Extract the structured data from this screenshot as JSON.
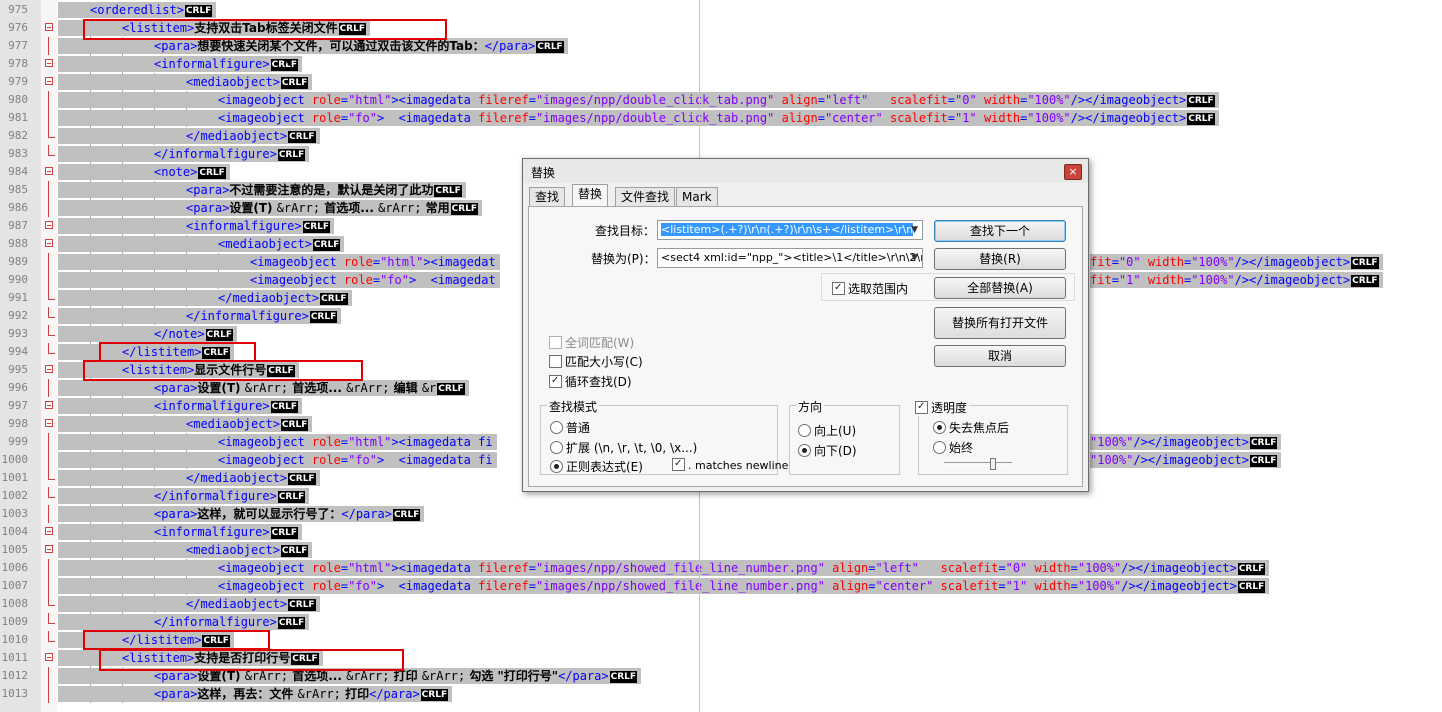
{
  "editor": {
    "lines": [
      {
        "n": "975",
        "indent": 0,
        "fold": "none",
        "segs": [
          [
            "tag",
            "<orderedlist>"
          ]
        ]
      },
      {
        "n": "976",
        "indent": 1,
        "fold": "open",
        "segs": [
          [
            "tag",
            "<listitem>"
          ],
          [
            "txt",
            "支持双击Tab标签关闭文件"
          ]
        ]
      },
      {
        "n": "977",
        "indent": 2,
        "fold": "line",
        "segs": [
          [
            "tag",
            "<para>"
          ],
          [
            "txt",
            "想要快速关闭某个文件，可以通过双击该文件的Tab："
          ],
          [
            "tag",
            "</para>"
          ]
        ]
      },
      {
        "n": "978",
        "indent": 2,
        "fold": "open",
        "segs": [
          [
            "tag",
            "<informalfigure>"
          ]
        ]
      },
      {
        "n": "979",
        "indent": 3,
        "fold": "open",
        "segs": [
          [
            "tag",
            "<mediaobject>"
          ]
        ]
      },
      {
        "n": "980",
        "indent": 4,
        "fold": "line",
        "segs": [
          [
            "tag",
            "<imageobject "
          ],
          [
            "attr",
            "role"
          ],
          [
            "tag",
            "="
          ],
          [
            "val",
            "\"html\""
          ],
          [
            "tag",
            "><imagedata "
          ],
          [
            "attr",
            "fileref"
          ],
          [
            "tag",
            "="
          ],
          [
            "val",
            "\"images/npp/double_click_tab.png\""
          ],
          [
            "tag",
            " "
          ],
          [
            "attr",
            "align"
          ],
          [
            "tag",
            "="
          ],
          [
            "val",
            "\"left\""
          ],
          [
            "tag",
            "   "
          ],
          [
            "attr",
            "scalefit"
          ],
          [
            "tag",
            "="
          ],
          [
            "val",
            "\"0\""
          ],
          [
            "tag",
            " "
          ],
          [
            "attr",
            "width"
          ],
          [
            "tag",
            "="
          ],
          [
            "val",
            "\"100%\""
          ],
          [
            "tag",
            "/></imageobject>"
          ]
        ]
      },
      {
        "n": "981",
        "indent": 4,
        "fold": "line",
        "segs": [
          [
            "tag",
            "<imageobject "
          ],
          [
            "attr",
            "role"
          ],
          [
            "tag",
            "="
          ],
          [
            "val",
            "\"fo\""
          ],
          [
            "tag",
            ">  <imagedata "
          ],
          [
            "attr",
            "fileref"
          ],
          [
            "tag",
            "="
          ],
          [
            "val",
            "\"images/npp/double_click_tab.png\""
          ],
          [
            "tag",
            " "
          ],
          [
            "attr",
            "align"
          ],
          [
            "tag",
            "="
          ],
          [
            "val",
            "\"center\""
          ],
          [
            "tag",
            " "
          ],
          [
            "attr",
            "scalefit"
          ],
          [
            "tag",
            "="
          ],
          [
            "val",
            "\"1\""
          ],
          [
            "tag",
            " "
          ],
          [
            "attr",
            "width"
          ],
          [
            "tag",
            "="
          ],
          [
            "val",
            "\"100%\""
          ],
          [
            "tag",
            "/></imageobject>"
          ]
        ]
      },
      {
        "n": "982",
        "indent": 3,
        "fold": "end",
        "segs": [
          [
            "tag",
            "</mediaobject>"
          ]
        ]
      },
      {
        "n": "983",
        "indent": 2,
        "fold": "end",
        "segs": [
          [
            "tag",
            "</informalfigure>"
          ]
        ]
      },
      {
        "n": "984",
        "indent": 2,
        "fold": "open",
        "segs": [
          [
            "tag",
            "<note>"
          ]
        ]
      },
      {
        "n": "985",
        "indent": 3,
        "fold": "line",
        "segs": [
          [
            "tag",
            "<para>"
          ],
          [
            "txt",
            "不过需要注意的是，默认是关闭了此功"
          ]
        ]
      },
      {
        "n": "986",
        "indent": 3,
        "fold": "line",
        "segs": [
          [
            "tag",
            "<para>"
          ],
          [
            "txt",
            "设置(T) "
          ],
          [
            "ent",
            "&rArr;"
          ],
          [
            "txt",
            " 首选项... "
          ],
          [
            "ent",
            "&rArr;"
          ],
          [
            "txt",
            " 常用"
          ]
        ]
      },
      {
        "n": "987",
        "indent": 3,
        "fold": "open",
        "segs": [
          [
            "tag",
            "<informalfigure>"
          ]
        ]
      },
      {
        "n": "988",
        "indent": 4,
        "fold": "open",
        "segs": [
          [
            "tag",
            "<mediaobject>"
          ]
        ]
      },
      {
        "n": "989",
        "indent": 5,
        "fold": "line",
        "segs": [
          [
            "tag",
            "<imageobject "
          ],
          [
            "attr",
            "role"
          ],
          [
            "tag",
            "="
          ],
          [
            "val",
            "\"html\""
          ],
          [
            "tag",
            "><imagedat"
          ]
        ]
      },
      {
        "n": "990",
        "indent": 5,
        "fold": "line",
        "segs": [
          [
            "tag",
            "<imageobject "
          ],
          [
            "attr",
            "role"
          ],
          [
            "tag",
            "="
          ],
          [
            "val",
            "\"fo\""
          ],
          [
            "tag",
            ">  <imagedat"
          ]
        ]
      },
      {
        "n": "991",
        "indent": 4,
        "fold": "end",
        "segs": [
          [
            "tag",
            "</mediaobject>"
          ]
        ]
      },
      {
        "n": "992",
        "indent": 3,
        "fold": "end",
        "segs": [
          [
            "tag",
            "</informalfigure>"
          ]
        ]
      },
      {
        "n": "993",
        "indent": 2,
        "fold": "end",
        "segs": [
          [
            "tag",
            "</note>"
          ]
        ]
      },
      {
        "n": "994",
        "indent": 1,
        "fold": "end",
        "segs": [
          [
            "tag",
            "</listitem>"
          ]
        ]
      },
      {
        "n": "995",
        "indent": 1,
        "fold": "open",
        "segs": [
          [
            "tag",
            "<listitem>"
          ],
          [
            "txt",
            "显示文件行号"
          ]
        ]
      },
      {
        "n": "996",
        "indent": 2,
        "fold": "line",
        "segs": [
          [
            "tag",
            "<para>"
          ],
          [
            "txt",
            "设置(T) "
          ],
          [
            "ent",
            "&rArr;"
          ],
          [
            "txt",
            " 首选项... "
          ],
          [
            "ent",
            "&rArr;"
          ],
          [
            "txt",
            " 编辑 "
          ],
          [
            "ent",
            "&r"
          ]
        ]
      },
      {
        "n": "997",
        "indent": 2,
        "fold": "open",
        "segs": [
          [
            "tag",
            "<informalfigure>"
          ]
        ]
      },
      {
        "n": "998",
        "indent": 3,
        "fold": "open",
        "segs": [
          [
            "tag",
            "<mediaobject>"
          ]
        ]
      },
      {
        "n": "999",
        "indent": 4,
        "fold": "line",
        "segs": [
          [
            "tag",
            "<imageobject "
          ],
          [
            "attr",
            "role"
          ],
          [
            "tag",
            "="
          ],
          [
            "val",
            "\"html\""
          ],
          [
            "tag",
            "><imagedata fi"
          ]
        ]
      },
      {
        "n": "1000",
        "indent": 4,
        "fold": "line",
        "segs": [
          [
            "tag",
            "<imageobject "
          ],
          [
            "attr",
            "role"
          ],
          [
            "tag",
            "="
          ],
          [
            "val",
            "\"fo\""
          ],
          [
            "tag",
            ">  <imagedata fi"
          ]
        ]
      },
      {
        "n": "1001",
        "indent": 3,
        "fold": "end",
        "segs": [
          [
            "tag",
            "</mediaobject>"
          ]
        ]
      },
      {
        "n": "1002",
        "indent": 2,
        "fold": "end",
        "segs": [
          [
            "tag",
            "</informalfigure>"
          ]
        ]
      },
      {
        "n": "1003",
        "indent": 2,
        "fold": "line",
        "segs": [
          [
            "tag",
            "<para>"
          ],
          [
            "txt",
            "这样，就可以显示行号了："
          ],
          [
            "tag",
            "</para>"
          ]
        ]
      },
      {
        "n": "1004",
        "indent": 2,
        "fold": "open",
        "segs": [
          [
            "tag",
            "<informalfigure>"
          ]
        ]
      },
      {
        "n": "1005",
        "indent": 3,
        "fold": "open",
        "segs": [
          [
            "tag",
            "<mediaobject>"
          ]
        ]
      },
      {
        "n": "1006",
        "indent": 4,
        "fold": "line",
        "segs": [
          [
            "tag",
            "<imageobject "
          ],
          [
            "attr",
            "role"
          ],
          [
            "tag",
            "="
          ],
          [
            "val",
            "\"html\""
          ],
          [
            "tag",
            "><imagedata "
          ],
          [
            "attr",
            "fileref"
          ],
          [
            "tag",
            "="
          ],
          [
            "val",
            "\"images/npp/showed_file_line_number.png\""
          ],
          [
            "tag",
            " "
          ],
          [
            "attr",
            "align"
          ],
          [
            "tag",
            "="
          ],
          [
            "val",
            "\"left\""
          ],
          [
            "tag",
            "   "
          ],
          [
            "attr",
            "scalefit"
          ],
          [
            "tag",
            "="
          ],
          [
            "val",
            "\"0\""
          ],
          [
            "tag",
            " "
          ],
          [
            "attr",
            "width"
          ],
          [
            "tag",
            "="
          ],
          [
            "val",
            "\"100%\""
          ],
          [
            "tag",
            "/></imageobject>"
          ]
        ]
      },
      {
        "n": "1007",
        "indent": 4,
        "fold": "line",
        "segs": [
          [
            "tag",
            "<imageobject "
          ],
          [
            "attr",
            "role"
          ],
          [
            "tag",
            "="
          ],
          [
            "val",
            "\"fo\""
          ],
          [
            "tag",
            ">  <imagedata "
          ],
          [
            "attr",
            "fileref"
          ],
          [
            "tag",
            "="
          ],
          [
            "val",
            "\"images/npp/showed_file_line_number.png\""
          ],
          [
            "tag",
            " "
          ],
          [
            "attr",
            "align"
          ],
          [
            "tag",
            "="
          ],
          [
            "val",
            "\"center\""
          ],
          [
            "tag",
            " "
          ],
          [
            "attr",
            "scalefit"
          ],
          [
            "tag",
            "="
          ],
          [
            "val",
            "\"1\""
          ],
          [
            "tag",
            " "
          ],
          [
            "attr",
            "width"
          ],
          [
            "tag",
            "="
          ],
          [
            "val",
            "\"100%\""
          ],
          [
            "tag",
            "/></imageobject>"
          ]
        ]
      },
      {
        "n": "1008",
        "indent": 3,
        "fold": "end",
        "segs": [
          [
            "tag",
            "</mediaobject>"
          ]
        ]
      },
      {
        "n": "1009",
        "indent": 2,
        "fold": "end",
        "segs": [
          [
            "tag",
            "</informalfigure>"
          ]
        ]
      },
      {
        "n": "1010",
        "indent": 1,
        "fold": "end",
        "segs": [
          [
            "tag",
            "</listitem>"
          ]
        ]
      },
      {
        "n": "1011",
        "indent": 1,
        "fold": "open",
        "segs": [
          [
            "tag",
            "<listitem>"
          ],
          [
            "txt",
            "支持是否打印行号"
          ]
        ]
      },
      {
        "n": "1012",
        "indent": 2,
        "fold": "line",
        "segs": [
          [
            "tag",
            "<para>"
          ],
          [
            "txt",
            "设置(T) "
          ],
          [
            "ent",
            "&rArr;"
          ],
          [
            "txt",
            " 首选项... "
          ],
          [
            "ent",
            "&rArr;"
          ],
          [
            "txt",
            " 打印 "
          ],
          [
            "ent",
            "&rArr;"
          ],
          [
            "txt",
            " 勾选 \"打印行号\""
          ],
          [
            "tag",
            "</para>"
          ]
        ]
      },
      {
        "n": "1013",
        "indent": 2,
        "fold": "line",
        "segs": [
          [
            "tag",
            "<para>"
          ],
          [
            "txt",
            "这样，再去：文件 "
          ],
          [
            "ent",
            "&rArr;"
          ],
          [
            "txt",
            " 打印"
          ],
          [
            "tag",
            "</para>"
          ]
        ]
      }
    ],
    "eol_marker": "CRLF",
    "right_parts": {
      "989": [
        [
          "attr",
          "fit"
        ],
        [
          "tag",
          "="
        ],
        [
          "val",
          "\"0\""
        ],
        [
          "tag",
          " "
        ],
        [
          "attr",
          "width"
        ],
        [
          "tag",
          "="
        ],
        [
          "val",
          "\"100%\""
        ],
        [
          "tag",
          "/></imageobject>"
        ]
      ],
      "990": [
        [
          "attr",
          "fit"
        ],
        [
          "tag",
          "="
        ],
        [
          "val",
          "\"1\""
        ],
        [
          "tag",
          " "
        ],
        [
          "attr",
          "width"
        ],
        [
          "tag",
          "="
        ],
        [
          "val",
          "\"100%\""
        ],
        [
          "tag",
          "/></imageobject>"
        ]
      ],
      "999": [
        [
          "val",
          "\"100%\""
        ],
        [
          "tag",
          "/></imageobject>"
        ]
      ],
      "1000": [
        [
          "val",
          "\"100%\""
        ],
        [
          "tag",
          "/></imageobject>"
        ]
      ]
    }
  },
  "dialog": {
    "title": "替换",
    "close_label": "×",
    "tabs": [
      "查找",
      "替换",
      "文件查找",
      "Mark"
    ],
    "active_tab": "替换",
    "find_label": "查找目标：",
    "find_value": "<listitem>(.+?)\\r\\n(.+?)\\r\\n\\s+</listitem>\\r\\n",
    "replace_label": "替换为(P)：",
    "replace_value": "<sect4 xml:id=\"npp_\"><title>\\1</title>\\r\\n\\2\\r\\n",
    "btn_find_next": "查找下一个",
    "btn_replace": "替换(R)",
    "in_selection": "选取范围内",
    "btn_replace_all": "全部替换(A)",
    "btn_replace_all_open": "替换所有打开文件",
    "btn_cancel": "取消",
    "match_whole": "全词匹配(W)",
    "match_case": "匹配大小写(C)",
    "wrap_around": "循环查找(D)",
    "search_mode_title": "查找模式",
    "mode_normal": "普通",
    "mode_extended": "扩展 (\\n, \\r, \\t, \\0, \\x...)",
    "mode_regex": "正则表达式(E)",
    "dot_newline": ". matches newline",
    "direction_title": "方向",
    "dir_up": "向上(U)",
    "dir_down": "向下(D)",
    "transparency_title": "透明度",
    "trans_lose_focus": "失去焦点后",
    "trans_always": "始终"
  }
}
